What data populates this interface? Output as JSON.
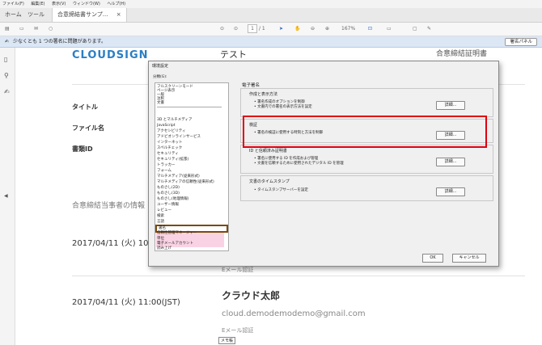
{
  "menu": [
    "ファイル(F)",
    "編集(E)",
    "表示(V)",
    "ウィンドウ(W)",
    "ヘルプ(H)"
  ],
  "tabs": {
    "home": "ホーム",
    "tools": "ツール",
    "doc": "合意締結書サンプ...",
    "close": "×"
  },
  "toolbar": {
    "page_current": "1",
    "page_total": "/ 1",
    "zoom": "167%"
  },
  "notice": {
    "text": "少なくとも 1 つの署名に問題があります。",
    "button": "署名パネル"
  },
  "document": {
    "logo": "CLOUDSIGN",
    "title": "テスト",
    "right_header": "合意締結証明書",
    "labels": {
      "title": "タイトル",
      "filename": "ファイル名",
      "docid": "書類ID"
    },
    "party_heading": "合意締結当事者の情報",
    "date1": "2017/04/11 (火) 10",
    "email_auth1": "Eメール認証",
    "name": "クラウド太郎",
    "date2": "2017/04/11 (火) 11:00(JST)",
    "email": "cloud.demodemodemo@gmail.com",
    "email_auth2": "Eメール認証",
    "sticker": "メモ帳"
  },
  "dialog": {
    "title": "環境設定",
    "category_label": "分類(G):",
    "categories_top": [
      "フルスクリーンモード",
      "ページ表示",
      "一般",
      "注釈",
      "文書"
    ],
    "categories": [
      "3D とマルチメディア",
      "JavaScript",
      "アクセシビリティ",
      "アドビオンラインサービス",
      "インターネット",
      "スペルチェック",
      "セキュリティ",
      "セキュリティ(拡張)",
      "トラッカー",
      "フォーム",
      "マルチメディア(従来形式)",
      "マルチメディアの信頼性(従来形式)",
      "ものさし(2D)",
      "ものさし(3D)",
      "ものさし(地理情報)",
      "ユーザー情報",
      "レビュー",
      "検索",
      "言語",
      "署名",
      "信頼性管理マネージャー",
      "単位",
      "電子メールアカウント",
      "読み上げ"
    ],
    "selected_category": "署名",
    "panel_title": "電子署名",
    "groups": [
      {
        "title": "作成と表示方法",
        "bullets": [
          "署名作成のオプションを制御",
          "文書内での署名の表示方法を設定"
        ],
        "button": "詳細..."
      },
      {
        "title": "検証",
        "bullets": [
          "署名の検証に使用する時刻と方法を制御"
        ],
        "button": "詳細..."
      },
      {
        "title": "ID と信頼済み証明書",
        "bullets": [
          "署名に使用する ID を作成および管理",
          "文書を信頼するために使用されたデジタル ID を管理"
        ],
        "button": "詳細..."
      },
      {
        "title": "文書のタイムスタンプ",
        "bullets": [
          "タイムスタンプサーバーを設定"
        ],
        "button": "詳細..."
      }
    ],
    "ok": "OK",
    "cancel": "キャンセル"
  },
  "colors": {
    "highlight_red": "#e00010",
    "selection_border": "#7a4a10",
    "logo_blue": "#2a7fc4",
    "notice_bg": "#dce7f5"
  }
}
